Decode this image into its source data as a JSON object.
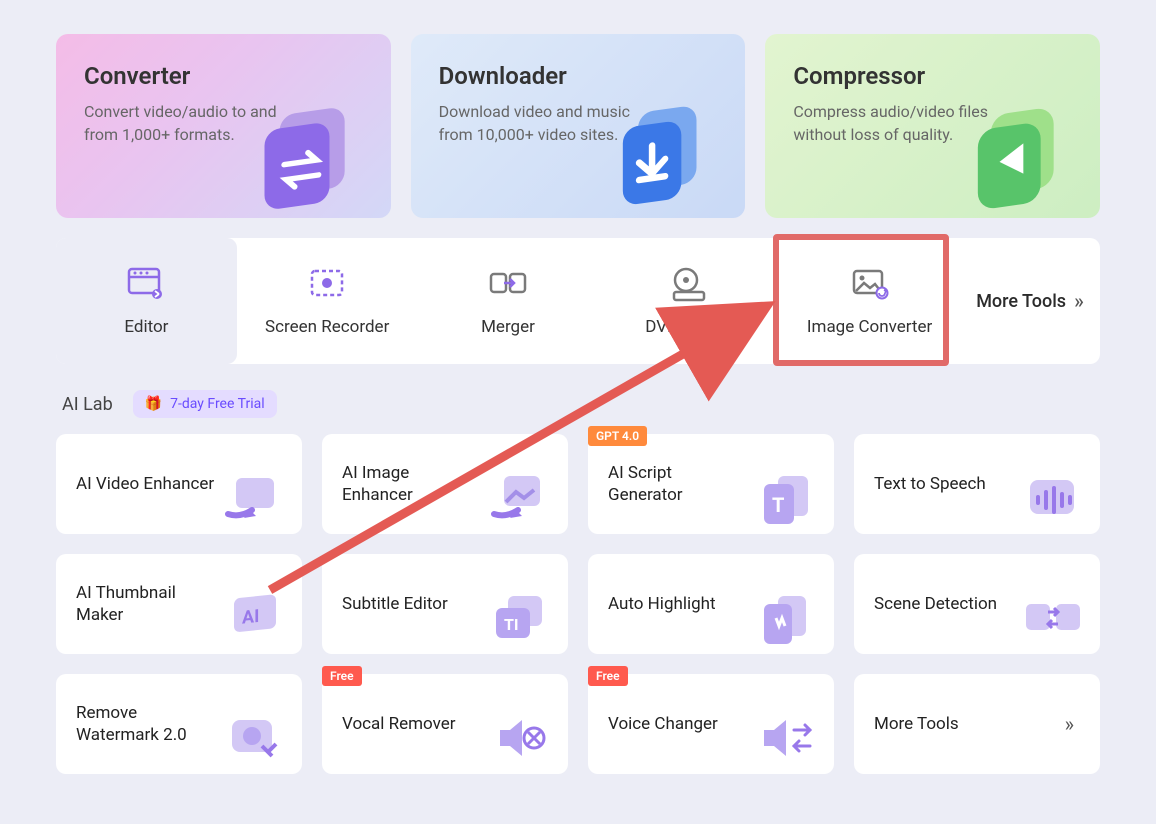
{
  "top_cards": {
    "converter": {
      "title": "Converter",
      "desc": "Convert video/audio to and from 1,000+ formats."
    },
    "downloader": {
      "title": "Downloader",
      "desc": "Download video and music from 10,000+ video sites."
    },
    "compressor": {
      "title": "Compressor",
      "desc": "Compress audio/video files without loss of quality."
    }
  },
  "toolbar": {
    "items": [
      {
        "label": "Editor"
      },
      {
        "label": "Screen Recorder"
      },
      {
        "label": "Merger"
      },
      {
        "label": "DVD Burner"
      },
      {
        "label": "Image Converter"
      }
    ],
    "more_label": "More Tools"
  },
  "ailab": {
    "title": "AI Lab",
    "trial_label": "7-day Free Trial"
  },
  "grid": {
    "items": [
      {
        "label": "AI Video Enhancer"
      },
      {
        "label": "AI Image Enhancer"
      },
      {
        "label": "AI Script Generator",
        "tag": "GPT 4.0",
        "tag_class": "tag-gpt"
      },
      {
        "label": "Text to Speech"
      },
      {
        "label": "AI Thumbnail Maker"
      },
      {
        "label": "Subtitle Editor"
      },
      {
        "label": "Auto Highlight"
      },
      {
        "label": "Scene Detection"
      },
      {
        "label": "Remove Watermark 2.0"
      },
      {
        "label": "Vocal Remover",
        "tag": "Free",
        "tag_class": "tag-free"
      },
      {
        "label": "Voice Changer",
        "tag": "Free",
        "tag_class": "tag-free"
      }
    ],
    "more_label": "More Tools"
  },
  "annotation": {
    "highlighted_tool": "Image Converter"
  }
}
